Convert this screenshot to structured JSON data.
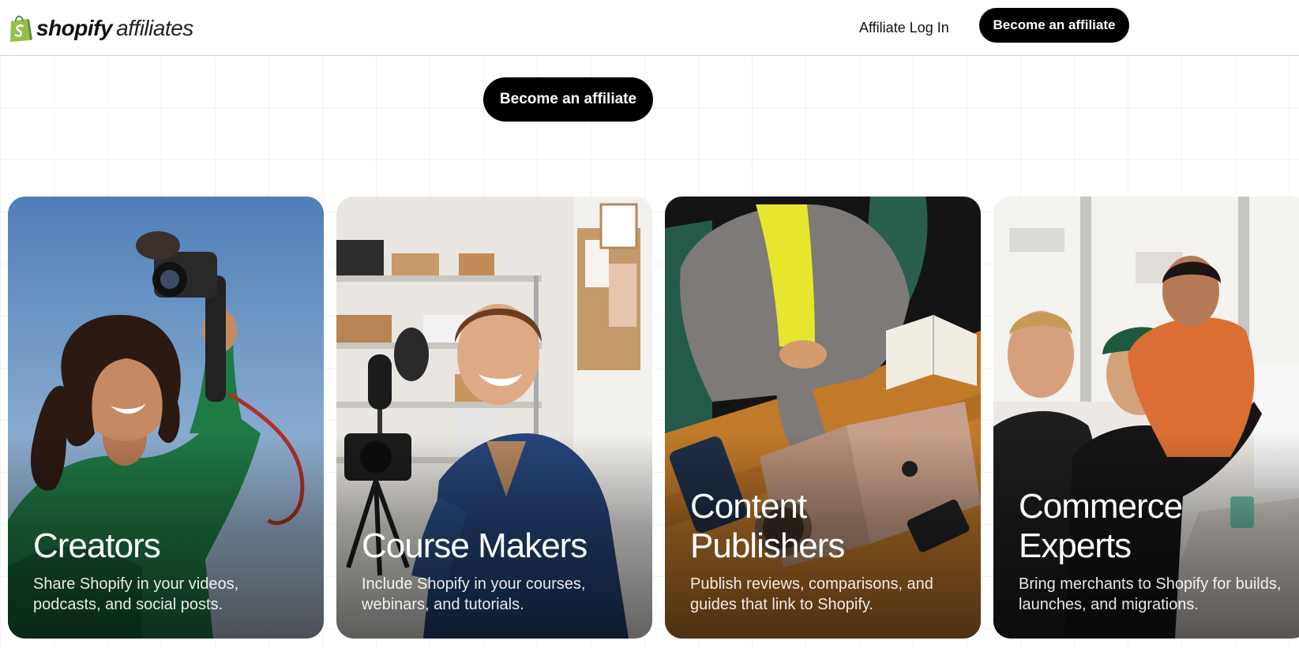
{
  "brand": {
    "name_bold": "shopify",
    "name_light": "affiliates",
    "color": "#95BF47"
  },
  "nav": {
    "login_label": "Affiliate Log In",
    "cta_label": "Become an affiliate"
  },
  "hero": {
    "cta_label": "Become an affiliate"
  },
  "cards": [
    {
      "title": "Creators",
      "description": "Share Shopify in your videos, podcasts, and social posts."
    },
    {
      "title": "Course Makers",
      "description": "Include Shopify in your courses, webinars, and tutorials."
    },
    {
      "title": "Content Publishers",
      "description": "Publish reviews, comparisons, and guides that link to Shopify."
    },
    {
      "title": "Commerce Experts",
      "description": "Bring merchants to Shopify for builds, launches, and migrations."
    }
  ],
  "colors": {
    "button_bg": "#000000",
    "button_text": "#FFFFFF",
    "header_border": "#D4D4D8"
  }
}
